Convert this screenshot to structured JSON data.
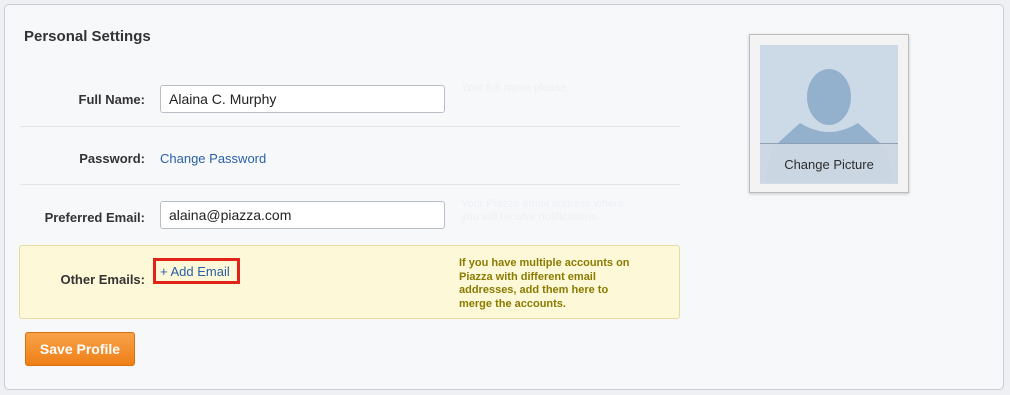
{
  "section": {
    "title": "Personal Settings"
  },
  "full_name": {
    "label": "Full Name:",
    "value": "Alaina C. Murphy",
    "hint": "Your full name please."
  },
  "password": {
    "label": "Password:",
    "link": "Change Password"
  },
  "preferred_email": {
    "label": "Preferred Email:",
    "value": "alaina@piazza.com",
    "hint": "Your Piazza email address where you will receive notifications."
  },
  "other_emails": {
    "label": "Other Emails:",
    "add_link": "+ Add Email",
    "hint": "If you have multiple accounts on Piazza with different email addresses, add them here to merge the accounts."
  },
  "actions": {
    "save_label": "Save Profile"
  },
  "avatar": {
    "change_label": "Change Picture",
    "icon": "user-silhouette-icon"
  },
  "colors": {
    "link": "#2a5fa8",
    "save_button": "#f28a22",
    "highlight_border": "#e2231a",
    "note_bg": "#fcf8d8"
  }
}
